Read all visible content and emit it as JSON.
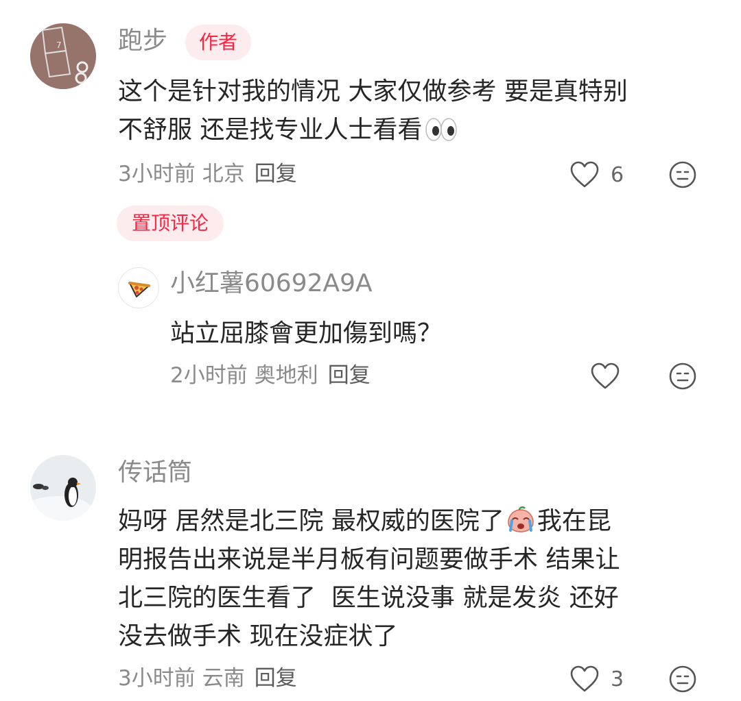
{
  "comments": [
    {
      "author": "跑步",
      "author_badge": "作者",
      "text_lines": [
        "这个是针对我的情况 大家仅做参考 要是真特别",
        "不舒服 还是找专业人士看看"
      ],
      "emoji": "eyes",
      "time": "3小时前",
      "location": "北京",
      "reply_label": "回复",
      "likes": "6",
      "pinned_label": "置顶评论",
      "replies": [
        {
          "author": "小红薯60692A9A",
          "text": "站立屈膝會更加傷到嗎？",
          "time": "2小时前",
          "location": "奥地利",
          "reply_label": "回复"
        }
      ]
    },
    {
      "author": "传话筒",
      "text_lines": [
        "妈呀 居然是北三院 最权威的医院了",
        "我在昆",
        "明报告出来说是半月板有问题要做手术 结果让",
        "北三院的医生看了  医生说没事 就是发炎 还好",
        "没去做手术 现在没症状了"
      ],
      "emoji": "crying-face",
      "time": "3小时前",
      "location": "云南",
      "reply_label": "回复",
      "likes": "3"
    }
  ],
  "icons": [
    "heart-icon",
    "dislike-face-icon",
    "pizza-icon",
    "eyes-emoji",
    "crying-emoji"
  ]
}
